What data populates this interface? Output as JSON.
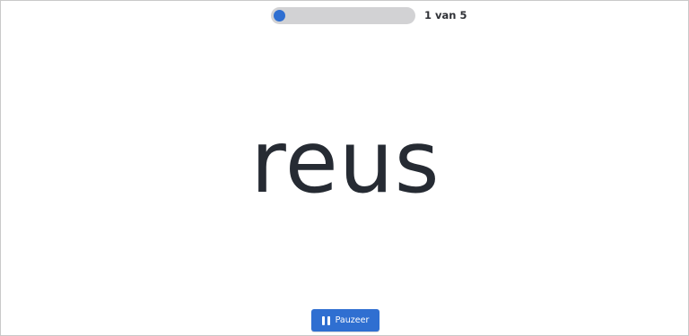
{
  "progress": {
    "current": 1,
    "total": 5,
    "label": "1 van 5",
    "fill_fraction": 0.2,
    "colors": {
      "fill": "#2f6fd1",
      "track": "#d2d2d4"
    }
  },
  "word": "reus",
  "controls": {
    "pause_label": "Pauzeer",
    "pause_icon": "pause-icon",
    "button_color": "#2f6fd1"
  }
}
